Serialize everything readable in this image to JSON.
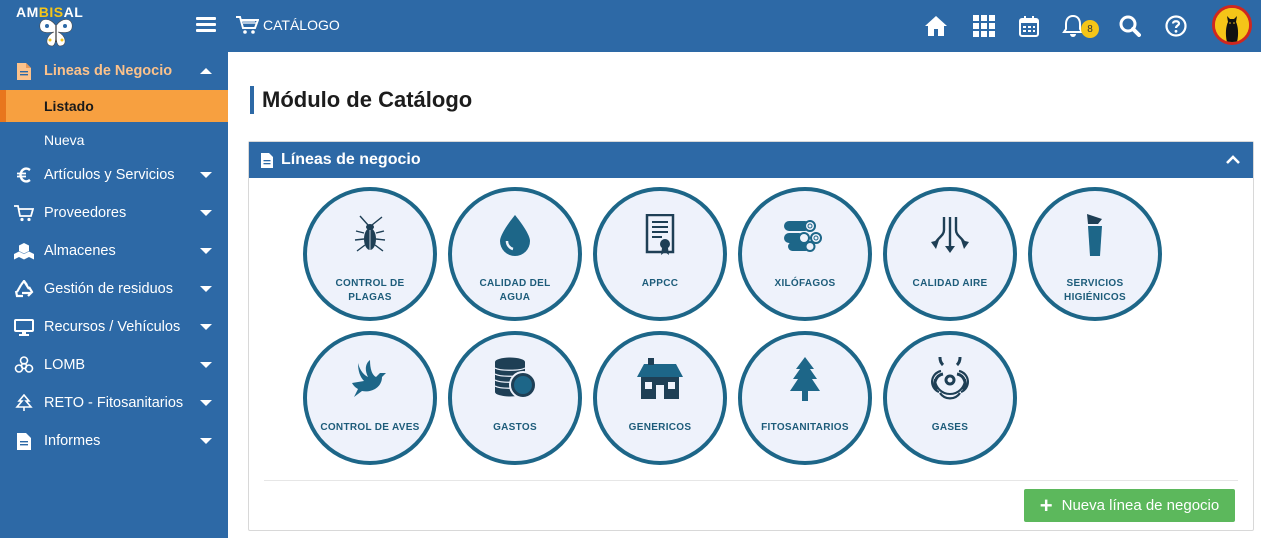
{
  "brand": {
    "logo_prefix": "AM",
    "logo_accent": "BIS",
    "logo_suffix": "AL"
  },
  "header": {
    "section_title": "CATÁLOGO",
    "notifications_count": "8"
  },
  "sidebar": {
    "items": [
      {
        "label": "Lineas de Negocio",
        "icon": "file-icon",
        "open": true
      },
      {
        "label": "Artículos y Servicios",
        "icon": "euro-icon"
      },
      {
        "label": "Proveedores",
        "icon": "cart-icon"
      },
      {
        "label": "Almacenes",
        "icon": "boxes-icon"
      },
      {
        "label": "Gestión de residuos",
        "icon": "recycle-icon"
      },
      {
        "label": "Recursos / Vehículos",
        "icon": "monitor-icon"
      },
      {
        "label": "LOMB",
        "icon": "biohazard-icon"
      },
      {
        "label": "RETO - Fitosanitarios",
        "icon": "tree-icon"
      },
      {
        "label": "Informes",
        "icon": "file-icon"
      }
    ],
    "subitems": [
      {
        "label": "Listado",
        "active": true
      },
      {
        "label": "Nueva"
      }
    ]
  },
  "main": {
    "page_title": "Módulo de Catálogo",
    "panel_title": "Líneas de negocio",
    "business_lines": [
      {
        "line1": "CONTROL DE",
        "line2": "PLAGAS",
        "icon": "cockroach-icon"
      },
      {
        "line1": "CALIDAD DEL",
        "line2": "AGUA",
        "icon": "water-drop-icon"
      },
      {
        "line1": "APPCC",
        "line2": "",
        "icon": "certificate-icon"
      },
      {
        "line1": "XILÓFAGOS",
        "line2": "",
        "icon": "logs-icon"
      },
      {
        "line1": "CALIDAD AIRE",
        "line2": "",
        "icon": "air-arrows-icon"
      },
      {
        "line1": "SERVICIOS",
        "line2": "HIGIÉNICOS",
        "icon": "cup-icon"
      },
      {
        "line1": "CONTROL DE AVES",
        "line2": "",
        "icon": "dove-icon"
      },
      {
        "line1": "GASTOS",
        "line2": "",
        "icon": "coins-icon"
      },
      {
        "line1": "GENERICOS",
        "line2": "",
        "icon": "house-icon"
      },
      {
        "line1": "FITOSANITARIOS",
        "line2": "",
        "icon": "tree-icon"
      },
      {
        "line1": "GASES",
        "line2": "",
        "icon": "biohazard-icon"
      }
    ],
    "add_button_label": "Nueva línea de negocio"
  },
  "colors": {
    "primary": "#2d69a6",
    "active_sub": "#f7a040",
    "circle_border": "#1d6688",
    "circle_fill": "#eef2fb",
    "success": "#5cb85c",
    "badge": "#f5c518"
  }
}
